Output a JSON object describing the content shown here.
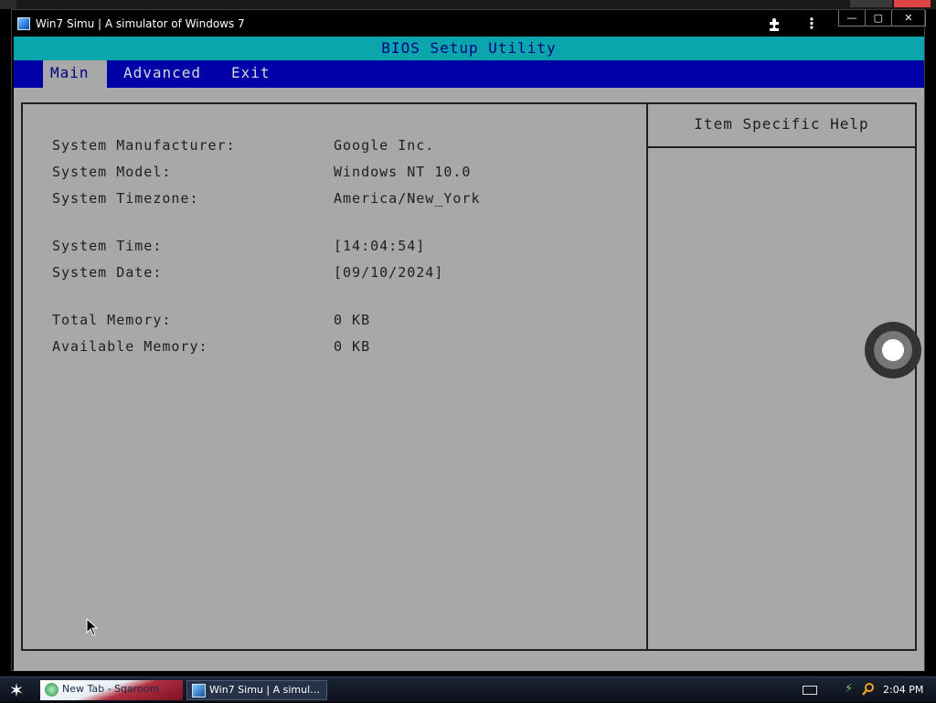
{
  "window": {
    "title": "Win7 Simu | A simulator of Windows 7",
    "controls": {
      "minimize": "—",
      "maximize": "▢",
      "close": "✕"
    }
  },
  "bios": {
    "header": "BIOS Setup Utility",
    "menu": [
      {
        "label": "Main",
        "active": true
      },
      {
        "label": "Advanced",
        "active": false
      },
      {
        "label": "Exit",
        "active": false
      }
    ],
    "help_title": "Item Specific Help",
    "fields": {
      "manufacturer": {
        "label": "System Manufacturer:",
        "value": "Google Inc."
      },
      "model": {
        "label": "System Model:",
        "value": "Windows NT 10.0"
      },
      "timezone": {
        "label": "System Timezone:",
        "value": "America/New_York"
      },
      "time": {
        "label": "System Time:",
        "value": "[14:04:54]"
      },
      "date": {
        "label": "System Date:",
        "value": "[09/10/2024]"
      },
      "total_memory": {
        "label": "Total Memory:",
        "value": "0 KB"
      },
      "available_memory": {
        "label": "Available Memory:",
        "value": "0 KB"
      }
    },
    "colors": {
      "header_bg": "#0ba6ac",
      "menubar_bg": "#0000a8",
      "panel_bg": "#a8a8a8",
      "text": "#202020"
    }
  },
  "taskbar": {
    "items": [
      {
        "label": "New Tab - Sqaroom",
        "icon": "globe-icon"
      },
      {
        "label": "Win7 Simu | A simul…",
        "icon": "app-icon"
      }
    ],
    "clock": "2:04 PM"
  },
  "icons": {
    "extension": "puzzle-icon",
    "menu": "kebab-menu-icon",
    "start": "start-star-icon"
  }
}
